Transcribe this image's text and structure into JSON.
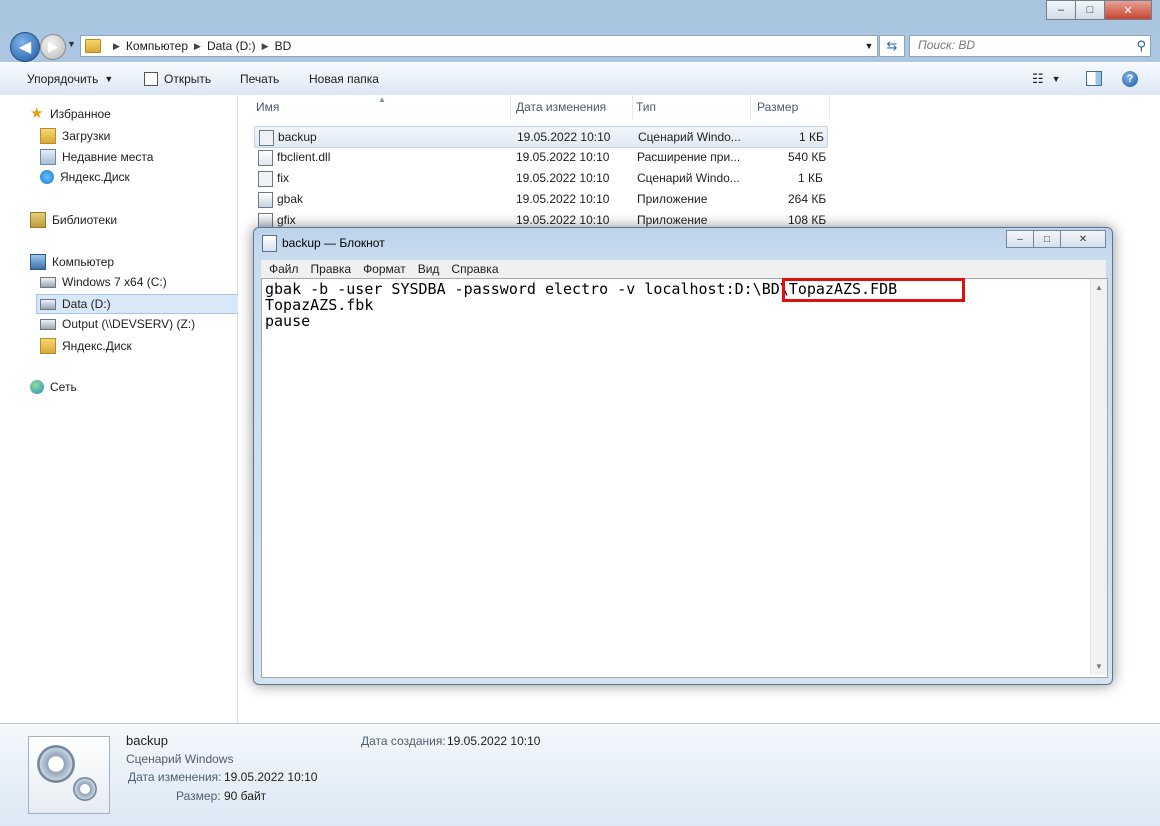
{
  "window": {
    "min": "–",
    "max": "□",
    "close": "✕"
  },
  "nav": {
    "back": "◀",
    "forward": "▶",
    "breadcrumbs": [
      "Компьютер",
      "Data (D:)",
      "BD"
    ],
    "search_placeholder": "Поиск: BD"
  },
  "toolbar": {
    "organize": "Упорядочить",
    "open": "Открыть",
    "print": "Печать",
    "new_folder": "Новая папка"
  },
  "sidebar": {
    "favorites": "Избранное",
    "downloads": "Загрузки",
    "recent": "Недавние места",
    "yandex1": "Яндекс.Диск",
    "libraries": "Библиотеки",
    "computer": "Компьютер",
    "win7": "Windows 7 x64 (C:)",
    "data": "Data (D:)",
    "output": "Output (\\\\DEVSERV) (Z:)",
    "yandex2": "Яндекс.Диск",
    "network": "Сеть"
  },
  "columns": {
    "name": "Имя",
    "date": "Дата изменения",
    "type": "Тип",
    "size": "Размер"
  },
  "files": [
    {
      "name": "backup",
      "date": "19.05.2022 10:10",
      "type": "Сценарий Windo...",
      "size": "1 КБ"
    },
    {
      "name": "fbclient.dll",
      "date": "19.05.2022 10:10",
      "type": "Расширение при...",
      "size": "540 КБ"
    },
    {
      "name": "fix",
      "date": "19.05.2022 10:10",
      "type": "Сценарий Windo...",
      "size": "1 КБ"
    },
    {
      "name": "gbak",
      "date": "19.05.2022 10:10",
      "type": "Приложение",
      "size": "264 КБ"
    },
    {
      "name": "gfix",
      "date": "19.05.2022 10:10",
      "type": "Приложение",
      "size": "108 КБ"
    }
  ],
  "notepad": {
    "title": "backup — Блокнот",
    "menu": [
      "Файл",
      "Правка",
      "Формат",
      "Вид",
      "Справка"
    ],
    "lines": [
      "gbak -b -user SYSDBA -password electro -v localhost:D:\\BD\\TopazAZS.FDB",
      "TopazAZS.fbk",
      "pause"
    ]
  },
  "details": {
    "name": "backup",
    "type": "Сценарий Windows",
    "modified_label": "Дата изменения:",
    "modified_value": "19.05.2022 10:10",
    "size_label": "Размер:",
    "size_value": "90 байт",
    "created_label": "Дата создания:",
    "created_value": "19.05.2022 10:10"
  }
}
